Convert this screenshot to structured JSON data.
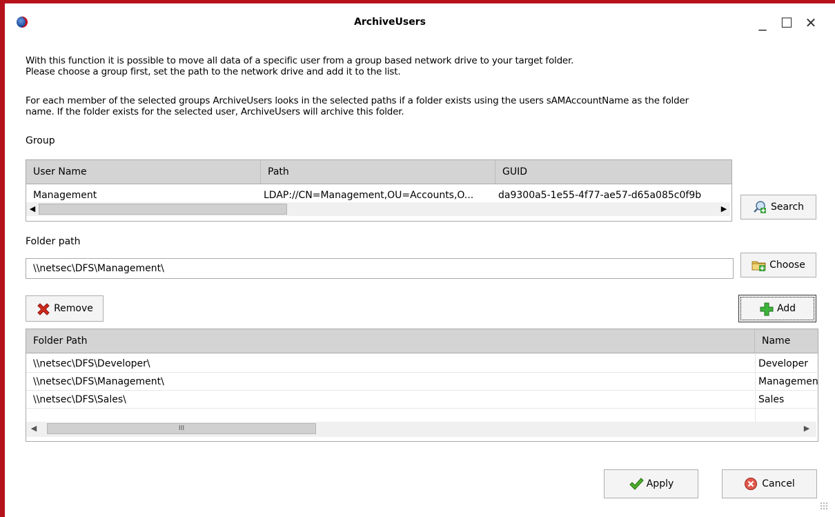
{
  "window": {
    "title": "ArchiveUsers",
    "minimize_glyph": "_",
    "maximize_glyph": "☐",
    "close_glyph": "✕"
  },
  "description": {
    "line1": "With this function it is possible to move all data of a specific user from a group based network drive to your target folder.",
    "line2": "Please choose a group first, set the path to the network drive and add it to the list.",
    "line3": "For each member of the selected groups ArchiveUsers looks in the selected paths if a folder exists using the users sAMAccountName as the folder",
    "line4": "name. If  the folder exists for the selected user, ArchiveUsers will archive this folder."
  },
  "group": {
    "label": "Group",
    "columns": [
      "User Name",
      "Path",
      "GUID"
    ],
    "rows": [
      [
        "Management",
        "LDAP://CN=Management,OU=Accounts,O...",
        "da9300a5-1e55-4f77-ae57-d65a085c0f9b"
      ]
    ],
    "search_label": "Search"
  },
  "folder": {
    "label": "Folder path",
    "value": "\\\\netsec\\DFS\\Management\\",
    "choose_label": "Choose"
  },
  "actions": {
    "remove_label": "Remove",
    "add_label": "Add"
  },
  "folder_list": {
    "columns": [
      "Folder Path",
      "Name"
    ],
    "rows": [
      [
        "\\\\netsec\\DFS\\Developer\\",
        "Developer"
      ],
      [
        "\\\\netsec\\DFS\\Management\\",
        "Management"
      ],
      [
        "\\\\netsec\\DFS\\Sales\\",
        "Sales"
      ]
    ],
    "scroll_thumb_glyph": "III"
  },
  "footer": {
    "apply_label": "Apply",
    "cancel_label": "Cancel"
  },
  "colors": {
    "window_border": "#b5121b",
    "header_bg": "#d4d4d4"
  }
}
